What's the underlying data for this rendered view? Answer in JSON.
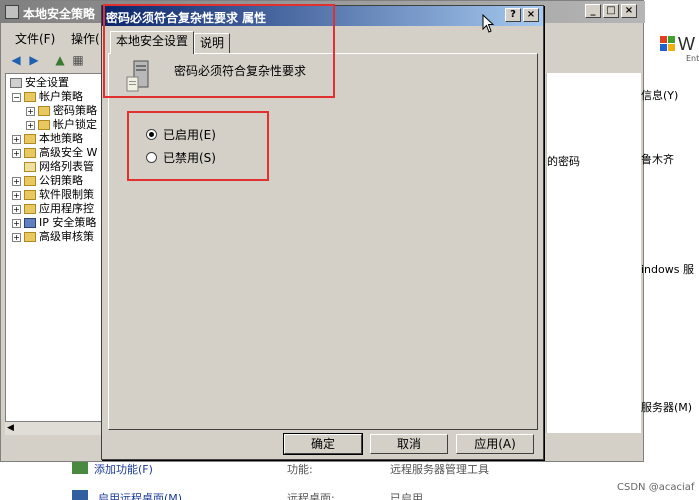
{
  "main_window": {
    "title": "本地安全策略",
    "minimize": "_",
    "maximize": "□",
    "close": "×"
  },
  "menu": {
    "file": "文件(F)",
    "action": "操作("
  },
  "tree": [
    {
      "label": "安全设置"
    },
    {
      "label": "帐户策略"
    },
    {
      "label": "密码策略"
    },
    {
      "label": "帐户锁定"
    },
    {
      "label": "本地策略"
    },
    {
      "label": "高级安全 W"
    },
    {
      "label": "网络列表管"
    },
    {
      "label": "公钥策略"
    },
    {
      "label": "软件限制策"
    },
    {
      "label": "应用程序控"
    },
    {
      "label": "IP 安全策略"
    },
    {
      "label": "高级审核策"
    }
  ],
  "background_text": {
    "info": "信息(Y)",
    "pwd": "的密码",
    "name": "鲁木齐",
    "windows": "indows 服",
    "server": "服务器(M)",
    "add_role": "添加功能(F)",
    "feature": "功能:",
    "remote_tools": "远程服务器管理工具",
    "enable_rdp": "启用远程桌面(M)",
    "rdp": "远程桌面:",
    "enabled": "已启用",
    "logo_w": "W",
    "logo_ent": "Ent"
  },
  "dialog": {
    "title": "密码必须符合复杂性要求 属性",
    "help": "?",
    "close": "×",
    "tabs": [
      "本地安全设置",
      "说明"
    ],
    "policy_name": "密码必须符合复杂性要求",
    "options": [
      {
        "label": "已启用(E)",
        "selected": true
      },
      {
        "label": "已禁用(S)",
        "selected": false
      }
    ],
    "buttons": {
      "ok": "确定",
      "cancel": "取消",
      "apply": "应用(A)"
    }
  },
  "watermark": "CSDN @acaciaf"
}
